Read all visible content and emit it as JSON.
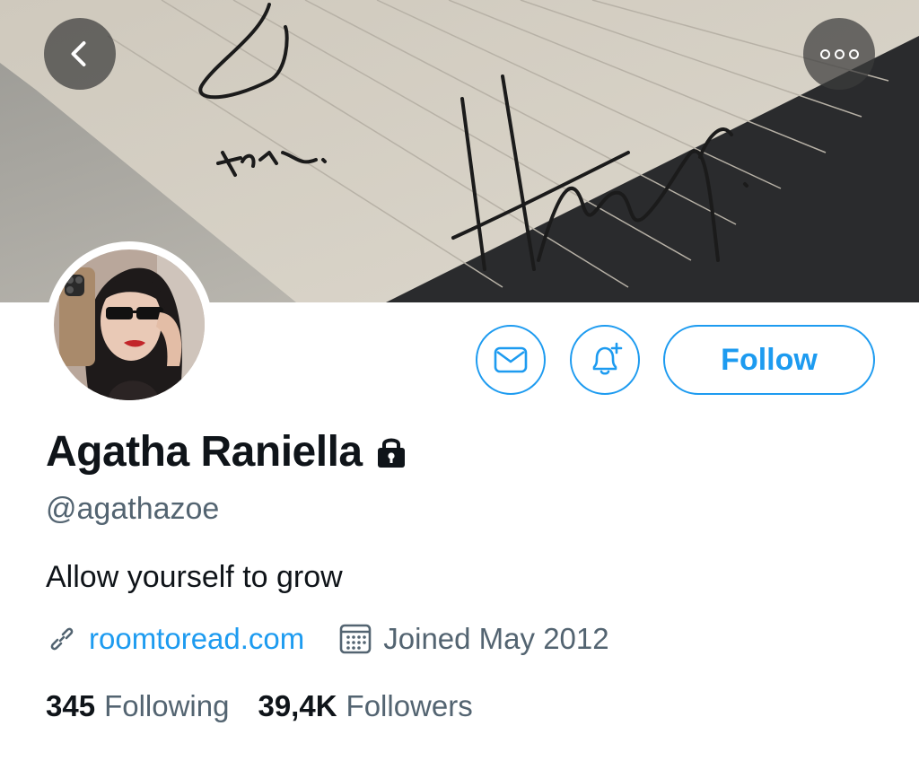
{
  "profile": {
    "name": "Agatha Raniella",
    "handle": "@agathazoe",
    "bio": "Allow yourself to grow",
    "website": "roomtoread.com",
    "joined": "Joined May 2012",
    "protected": true
  },
  "stats": {
    "following_count": "345",
    "following_label": "Following",
    "followers_count": "39,4K",
    "followers_label": "Followers"
  },
  "actions": {
    "follow_label": "Follow"
  },
  "icons": [
    "chevron-left-icon",
    "more-icon",
    "lock-icon",
    "mail-icon",
    "bell-plus-icon",
    "link-icon",
    "calendar-icon"
  ],
  "colors": {
    "accent": "#1d9bf0",
    "secondary_text": "#536471",
    "primary_text": "#0f1419"
  }
}
